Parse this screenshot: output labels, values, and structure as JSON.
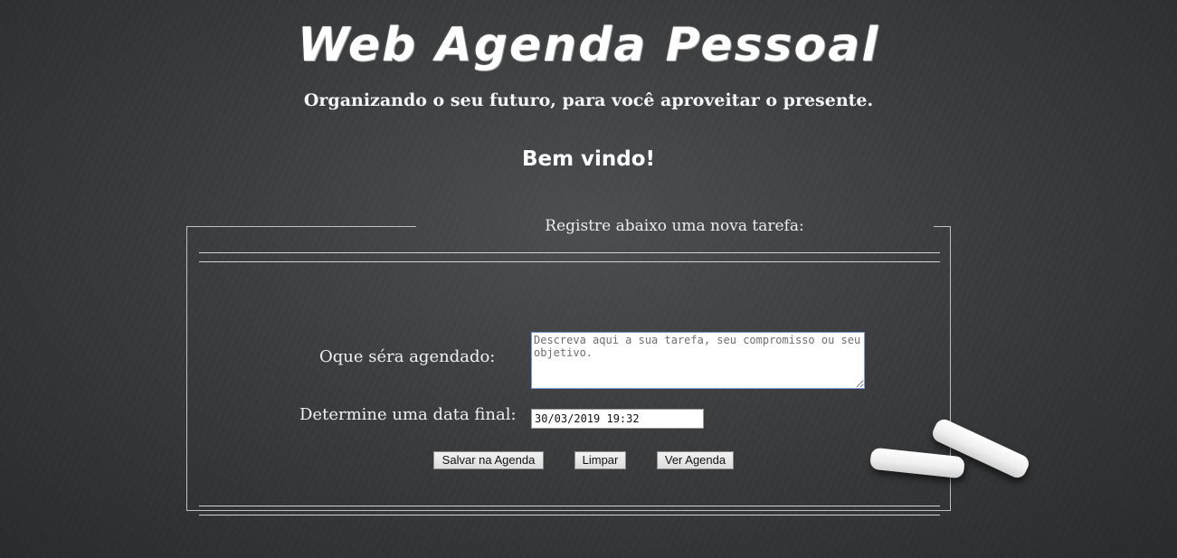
{
  "header": {
    "title": "Web Agenda Pessoal",
    "subtitle": "Organizando o seu futuro, para você aproveitar o presente.",
    "welcome": "Bem vindo!"
  },
  "form": {
    "legend": "Registre abaixo uma nova tarefa:",
    "task_label": "Oque séra agendado:",
    "task_placeholder": "Descreva aqui a sua tarefa, seu compromisso ou seu objetivo.",
    "task_value": "",
    "date_label": "Determine uma data final:",
    "date_value": "30/03/2019 19:32",
    "buttons": {
      "save": "Salvar na Agenda",
      "clear": "Limpar",
      "view": "Ver Agenda"
    }
  },
  "colors": {
    "background": "#3a3c3e",
    "text": "#ffffff",
    "frame_border": "#bfc0c1"
  }
}
